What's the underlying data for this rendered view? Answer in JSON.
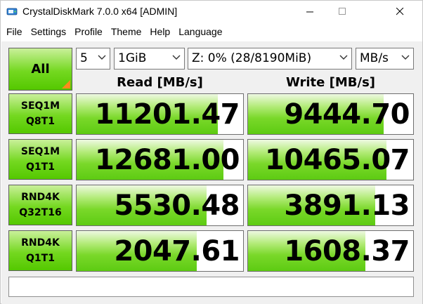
{
  "window": {
    "title": "CrystalDiskMark 7.0.0 x64 [ADMIN]",
    "icon": "crystaldiskmark-disk-icon"
  },
  "menu": {
    "file": "File",
    "settings": "Settings",
    "profile": "Profile",
    "theme": "Theme",
    "help": "Help",
    "language": "Language"
  },
  "controls": {
    "all_label": "All",
    "count": "5",
    "size": "1GiB",
    "drive": "Z: 0% (28/8190MiB)",
    "unit": "MB/s"
  },
  "headers": {
    "read": "Read [MB/s]",
    "write": "Write [MB/s]"
  },
  "tests": [
    {
      "line1": "SEQ1M",
      "line2": "Q8T1",
      "read": "11201.47",
      "write": "9444.70",
      "read_fill": 0.85,
      "write_fill": 0.82
    },
    {
      "line1": "SEQ1M",
      "line2": "Q1T1",
      "read": "12681.00",
      "write": "10465.07",
      "read_fill": 0.88,
      "write_fill": 0.84
    },
    {
      "line1": "RND4K",
      "line2": "Q32T16",
      "read": "5530.48",
      "write": "3891.13",
      "read_fill": 0.78,
      "write_fill": 0.77
    },
    {
      "line1": "RND4K",
      "line2": "Q1T1",
      "read": "2047.61",
      "write": "1608.37",
      "read_fill": 0.72,
      "write_fill": 0.71
    }
  ],
  "comment": "",
  "colors": {
    "button_green": "#74d820",
    "bar_green": "#7ad82a",
    "corner_orange": "#ff8a1c"
  }
}
